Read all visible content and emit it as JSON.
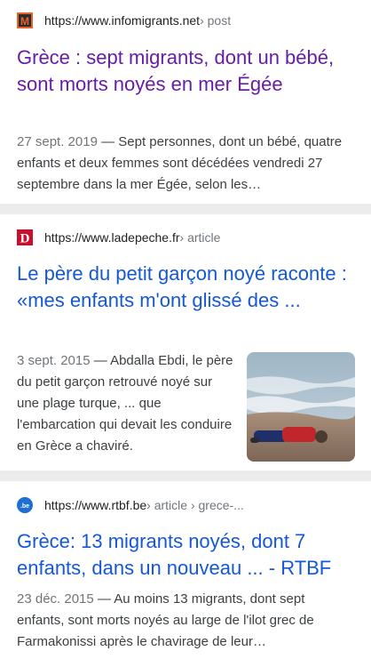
{
  "results": [
    {
      "favicon": {
        "letter": "M",
        "bg": "#e8632a",
        "icon": "infomigrants-logo-icon"
      },
      "url": "https://www.infomigrants.net",
      "crumb": " › post",
      "title": "Grèce : sept migrants, dont un bébé, sont morts noyés en mer Égée",
      "date": "27 sept. 2019",
      "snippet": " — Sept personnes, dont un bébé, quatre enfants et deux femmes sont décédées vendredi 27 septembre dans la mer Égée, selon les…"
    },
    {
      "favicon": {
        "letter": "D",
        "bg": "#c8102e",
        "icon": "ladepeche-logo-icon"
      },
      "url": "https://www.ladepeche.fr",
      "crumb": " › article",
      "title": "Le père du petit garçon noyé raconte : «mes enfants m'ont glissé des ...",
      "date": "3 sept. 2015",
      "snippet": " — Abdalla Ebdi, le père du petit garçon retrouvé noyé sur une plage turque, ... que l'embarcation qui devait les conduire en Grèce a chaviré.",
      "thumbnail": "beach-photo-thumbnail"
    },
    {
      "favicon": {
        "letter": ".be",
        "bg": "#1d6fd1",
        "icon": "rtbf-logo-icon"
      },
      "url": "https://www.rtbf.be",
      "crumb": " › article › grece-...",
      "title": "Grèce: 13 migrants noyés, dont 7 enfants, dans un nouveau ... - RTBF",
      "date": "23 déc. 2015",
      "snippet": " — Au moins 13 migrants, dont sept enfants, sont morts noyés au large de l'ilot grec de Farmakonissi après le chavirage de leur…"
    }
  ]
}
